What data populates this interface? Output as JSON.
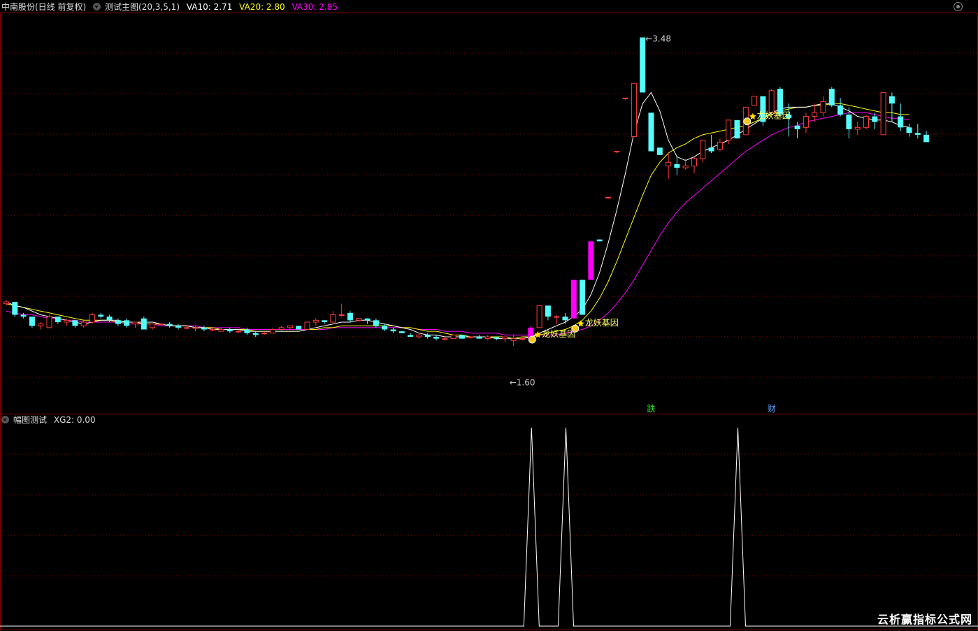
{
  "header": {
    "stock_label": "中南股份(日线 前复权)",
    "indicator_label": "测试主图(20,3,5,1)",
    "ma10_label": "VA10: 2.71",
    "ma20_label": "VA20: 2.80",
    "ma30_label": "VA30: 2.85"
  },
  "sub_header": {
    "indicator_label": "幅图测试",
    "value_label": "XG2: 0.00"
  },
  "watermark": "云析赢指标公式网",
  "colors": {
    "up": "#ff3c3c",
    "down": "#54fcfc",
    "signal": "#ff00ff",
    "ma10": "#ffffff",
    "ma20": "#ffff00",
    "ma30": "#ff00ff",
    "grid": "#8b0000",
    "text": "#dddddd"
  },
  "icons": {
    "collapse": "chevron-down-circle-icon",
    "close": "circle-close-icon",
    "money": "money-bag-icon",
    "star": "star-icon"
  },
  "chart_data": [
    {
      "type": "candlestick",
      "price_range": [
        1.5,
        3.6
      ],
      "high_label": "3.48",
      "low_label": "1.60",
      "annotations": [
        {
          "text": "龙妖基因",
          "bar": 61
        },
        {
          "text": "龙妖基因",
          "bar": 66
        },
        {
          "text": "龙妖基因",
          "bar": 86
        }
      ],
      "bottom_markers": [
        {
          "text": "跌",
          "bar": 75,
          "color": "#2ee62e"
        },
        {
          "text": "财",
          "bar": 89,
          "color": "#54a0ff"
        }
      ],
      "ohlc": [
        [
          2.03,
          2.05,
          2.02,
          2.04
        ],
        [
          2.04,
          2.04,
          1.96,
          1.97
        ],
        [
          1.97,
          1.98,
          1.95,
          1.96
        ],
        [
          1.96,
          1.96,
          1.9,
          1.91
        ],
        [
          1.91,
          1.93,
          1.89,
          1.92
        ],
        [
          1.9,
          1.97,
          1.9,
          1.96
        ],
        [
          1.96,
          1.96,
          1.92,
          1.93
        ],
        [
          1.93,
          1.95,
          1.91,
          1.94
        ],
        [
          1.94,
          1.94,
          1.9,
          1.91
        ],
        [
          1.91,
          1.94,
          1.9,
          1.93
        ],
        [
          1.93,
          1.98,
          1.92,
          1.97
        ],
        [
          1.97,
          1.98,
          1.95,
          1.96
        ],
        [
          1.96,
          1.97,
          1.93,
          1.94
        ],
        [
          1.94,
          1.95,
          1.91,
          1.92
        ],
        [
          1.94,
          1.95,
          1.9,
          1.91
        ],
        [
          1.92,
          1.93,
          1.9,
          1.93
        ],
        [
          1.95,
          1.96,
          1.89,
          1.89
        ],
        [
          1.9,
          1.92,
          1.89,
          1.92
        ],
        [
          1.92,
          1.92,
          1.91,
          1.92
        ],
        [
          1.92,
          1.93,
          1.9,
          1.91
        ],
        [
          1.91,
          1.92,
          1.89,
          1.9
        ],
        [
          1.9,
          1.91,
          1.89,
          1.9
        ],
        [
          1.9,
          1.91,
          1.88,
          1.9
        ],
        [
          1.9,
          1.91,
          1.88,
          1.89
        ],
        [
          1.89,
          1.9,
          1.88,
          1.89
        ],
        [
          1.88,
          1.9,
          1.88,
          1.89
        ],
        [
          1.89,
          1.9,
          1.87,
          1.88
        ],
        [
          1.88,
          1.89,
          1.87,
          1.88
        ],
        [
          1.89,
          1.9,
          1.86,
          1.87
        ],
        [
          1.87,
          1.88,
          1.85,
          1.86
        ],
        [
          1.87,
          1.88,
          1.86,
          1.87
        ],
        [
          1.87,
          1.9,
          1.87,
          1.89
        ],
        [
          1.89,
          1.91,
          1.88,
          1.9
        ],
        [
          1.9,
          1.91,
          1.89,
          1.91
        ],
        [
          1.91,
          1.91,
          1.89,
          1.89
        ],
        [
          1.89,
          1.93,
          1.89,
          1.93
        ],
        [
          1.93,
          1.95,
          1.91,
          1.94
        ],
        [
          1.94,
          1.94,
          1.92,
          1.93
        ],
        [
          1.93,
          1.99,
          1.93,
          1.97
        ],
        [
          1.97,
          2.03,
          1.96,
          1.97
        ],
        [
          1.98,
          1.99,
          1.93,
          1.94
        ],
        [
          1.94,
          1.95,
          1.93,
          1.95
        ],
        [
          1.95,
          1.95,
          1.92,
          1.94
        ],
        [
          1.94,
          1.95,
          1.9,
          1.91
        ],
        [
          1.91,
          1.92,
          1.88,
          1.89
        ],
        [
          1.89,
          1.9,
          1.87,
          1.88
        ],
        [
          1.88,
          1.88,
          1.87,
          1.87
        ],
        [
          1.86,
          1.87,
          1.85,
          1.85
        ],
        [
          1.85,
          1.87,
          1.84,
          1.86
        ],
        [
          1.86,
          1.87,
          1.84,
          1.85
        ],
        [
          1.85,
          1.86,
          1.83,
          1.84
        ],
        [
          1.84,
          1.85,
          1.83,
          1.84
        ],
        [
          1.84,
          1.86,
          1.84,
          1.86
        ],
        [
          1.86,
          1.86,
          1.84,
          1.84
        ],
        [
          1.85,
          1.85,
          1.84,
          1.85
        ],
        [
          1.85,
          1.86,
          1.84,
          1.84
        ],
        [
          1.84,
          1.86,
          1.83,
          1.85
        ],
        [
          1.85,
          1.85,
          1.83,
          1.84
        ],
        [
          1.84,
          1.85,
          1.82,
          1.85
        ],
        [
          1.83,
          1.86,
          1.8,
          1.84
        ],
        [
          1.84,
          1.85,
          1.83,
          1.84
        ],
        [
          1.84,
          1.91,
          1.84,
          1.9
        ],
        [
          1.9,
          2.02,
          1.9,
          2.02
        ],
        [
          2.02,
          2.02,
          1.94,
          1.96
        ],
        [
          1.96,
          1.97,
          1.92,
          1.96
        ],
        [
          1.96,
          1.98,
          1.92,
          1.94
        ],
        [
          1.95,
          2.16,
          1.95,
          2.16
        ],
        [
          2.16,
          2.16,
          1.97,
          1.97
        ],
        [
          2.16,
          2.37,
          2.16,
          2.37
        ],
        [
          2.38,
          2.38,
          2.37,
          2.37
        ],
        [
          2.61,
          2.61,
          2.6,
          2.61
        ],
        [
          2.86,
          2.86,
          2.85,
          2.86
        ],
        [
          3.15,
          3.15,
          3.14,
          3.15
        ],
        [
          2.94,
          3.23,
          2.94,
          3.23
        ],
        [
          3.48,
          3.48,
          3.18,
          3.18
        ],
        [
          3.07,
          3.07,
          2.86,
          2.86
        ],
        [
          2.88,
          2.88,
          2.84,
          2.84
        ],
        [
          2.78,
          2.85,
          2.71,
          2.8
        ],
        [
          2.79,
          2.83,
          2.73,
          2.77
        ],
        [
          2.77,
          2.82,
          2.76,
          2.78
        ],
        [
          2.78,
          2.83,
          2.74,
          2.82
        ],
        [
          2.82,
          2.92,
          2.8,
          2.92
        ],
        [
          2.88,
          2.95,
          2.85,
          2.86
        ],
        [
          2.87,
          2.93,
          2.86,
          2.91
        ],
        [
          2.92,
          3.02,
          2.9,
          3.03
        ],
        [
          3.03,
          3.03,
          2.93,
          2.93
        ],
        [
          2.95,
          3.07,
          2.95,
          3.1
        ],
        [
          3.11,
          3.16,
          3.11,
          3.16
        ],
        [
          3.16,
          3.12,
          3.0,
          3.02
        ],
        [
          3.07,
          3.2,
          3.06,
          3.19
        ],
        [
          3.2,
          3.21,
          3.05,
          3.06
        ],
        [
          3.06,
          3.12,
          2.94,
          3.04
        ],
        [
          3.0,
          3.02,
          2.93,
          2.98
        ],
        [
          2.99,
          3.07,
          2.96,
          3.05
        ],
        [
          3.05,
          3.12,
          3.02,
          3.07
        ],
        [
          3.07,
          3.16,
          3.05,
          3.13
        ],
        [
          3.2,
          3.21,
          3.1,
          3.11
        ],
        [
          3.11,
          3.15,
          3.05,
          3.06
        ],
        [
          3.06,
          3.1,
          2.93,
          2.98
        ],
        [
          2.98,
          3.02,
          2.95,
          2.99
        ],
        [
          2.99,
          3.06,
          2.98,
          3.05
        ],
        [
          3.05,
          3.07,
          2.98,
          3.02
        ],
        [
          2.95,
          3.11,
          2.95,
          3.18
        ],
        [
          3.16,
          3.18,
          3.02,
          3.12
        ],
        [
          3.05,
          3.12,
          2.97,
          2.99
        ],
        [
          2.99,
          3.01,
          2.94,
          2.96
        ],
        [
          2.96,
          3.01,
          2.93,
          2.95
        ],
        [
          2.95,
          2.97,
          2.91,
          2.91
        ]
      ],
      "ma10": [
        2.04,
        2.02,
        2.01,
        1.99,
        1.97,
        1.96,
        1.95,
        1.94,
        1.93,
        1.92,
        1.93,
        1.94,
        1.94,
        1.94,
        1.93,
        1.93,
        1.93,
        1.93,
        1.92,
        1.91,
        1.91,
        1.91,
        1.9,
        1.9,
        1.89,
        1.89,
        1.89,
        1.89,
        1.88,
        1.88,
        1.88,
        1.88,
        1.88,
        1.88,
        1.88,
        1.89,
        1.9,
        1.91,
        1.92,
        1.93,
        1.93,
        1.94,
        1.94,
        1.93,
        1.92,
        1.91,
        1.9,
        1.89,
        1.87,
        1.86,
        1.86,
        1.85,
        1.85,
        1.85,
        1.85,
        1.85,
        1.85,
        1.84,
        1.84,
        1.84,
        1.84,
        1.85,
        1.87,
        1.89,
        1.91,
        1.93,
        1.96,
        2.0,
        2.08,
        2.2,
        2.36,
        2.54,
        2.74,
        2.96,
        3.12,
        3.18,
        3.08,
        2.92,
        2.83,
        2.81,
        2.83,
        2.86,
        2.88,
        2.9,
        2.92,
        2.95,
        2.98,
        3.01,
        3.04,
        3.07,
        3.09,
        3.1,
        3.1,
        3.1,
        3.11,
        3.12,
        3.12,
        3.1,
        3.08,
        3.05,
        3.04,
        3.03,
        3.03,
        3.02,
        3.0,
        2.99
      ],
      "ma20": [
        2.03,
        2.02,
        2.01,
        2.0,
        1.99,
        1.98,
        1.97,
        1.96,
        1.95,
        1.94,
        1.94,
        1.94,
        1.94,
        1.93,
        1.93,
        1.93,
        1.92,
        1.92,
        1.92,
        1.91,
        1.91,
        1.91,
        1.9,
        1.9,
        1.9,
        1.89,
        1.89,
        1.89,
        1.89,
        1.88,
        1.88,
        1.88,
        1.88,
        1.88,
        1.88,
        1.89,
        1.89,
        1.9,
        1.9,
        1.91,
        1.91,
        1.91,
        1.91,
        1.91,
        1.91,
        1.91,
        1.9,
        1.9,
        1.89,
        1.88,
        1.88,
        1.87,
        1.86,
        1.86,
        1.85,
        1.85,
        1.85,
        1.85,
        1.85,
        1.84,
        1.85,
        1.85,
        1.86,
        1.87,
        1.88,
        1.89,
        1.91,
        1.94,
        1.99,
        2.06,
        2.15,
        2.26,
        2.38,
        2.5,
        2.62,
        2.73,
        2.8,
        2.85,
        2.88,
        2.9,
        2.93,
        2.95,
        2.96,
        2.97,
        2.98,
        2.99,
        3.0,
        3.02,
        3.04,
        3.06,
        3.08,
        3.09,
        3.1,
        3.1,
        3.11,
        3.11,
        3.12,
        3.12,
        3.11,
        3.1,
        3.09,
        3.08,
        3.07,
        3.07,
        3.06,
        3.06
      ],
      "ma30": [
        1.99,
        1.98,
        1.97,
        1.97,
        1.96,
        1.95,
        1.95,
        1.94,
        1.94,
        1.93,
        1.93,
        1.93,
        1.93,
        1.93,
        1.92,
        1.92,
        1.92,
        1.92,
        1.91,
        1.91,
        1.91,
        1.91,
        1.91,
        1.9,
        1.9,
        1.9,
        1.9,
        1.9,
        1.89,
        1.89,
        1.89,
        1.89,
        1.89,
        1.89,
        1.89,
        1.89,
        1.89,
        1.89,
        1.9,
        1.9,
        1.9,
        1.9,
        1.9,
        1.9,
        1.9,
        1.9,
        1.9,
        1.9,
        1.89,
        1.89,
        1.89,
        1.88,
        1.88,
        1.88,
        1.87,
        1.87,
        1.87,
        1.87,
        1.86,
        1.86,
        1.86,
        1.86,
        1.86,
        1.86,
        1.86,
        1.87,
        1.88,
        1.89,
        1.91,
        1.94,
        1.98,
        2.03,
        2.09,
        2.16,
        2.24,
        2.32,
        2.4,
        2.47,
        2.53,
        2.58,
        2.62,
        2.66,
        2.7,
        2.74,
        2.78,
        2.82,
        2.86,
        2.89,
        2.92,
        2.95,
        2.97,
        2.99,
        3.0,
        3.02,
        3.03,
        3.04,
        3.05,
        3.06,
        3.07,
        3.07,
        3.07,
        3.06,
        3.05,
        3.04,
        3.04,
        3.03
      ]
    },
    {
      "type": "line",
      "series": [
        {
          "name": "XG2",
          "spikes_at_bars": [
            61,
            65,
            85
          ]
        }
      ],
      "ylim": [
        0,
        1
      ]
    }
  ]
}
